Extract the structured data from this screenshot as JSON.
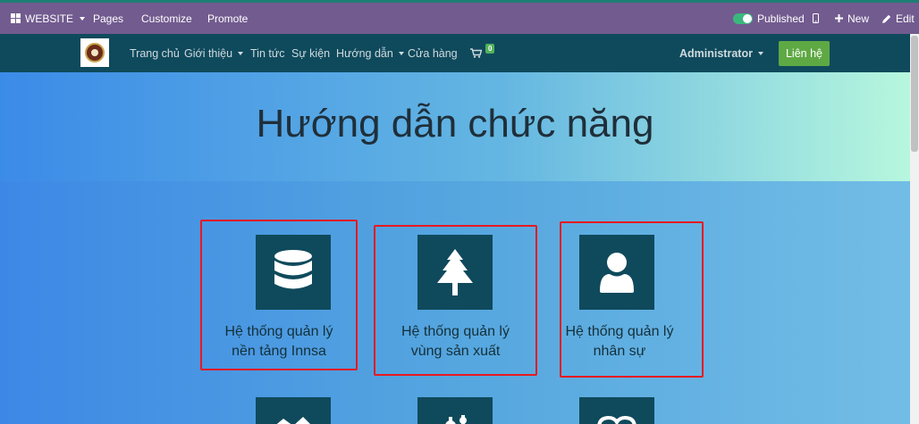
{
  "editor_bar": {
    "website": "WEBSITE",
    "pages": "Pages",
    "customize": "Customize",
    "promote": "Promote",
    "published": "Published",
    "new": "New",
    "edit": "Edit"
  },
  "navbar": {
    "items": [
      "Trang chủ",
      "Giới thiệu",
      "Tin tức",
      "Sự kiện",
      "Hướng dẫn",
      "Cửa hàng"
    ],
    "cart_count": "0",
    "user": "Administrator",
    "contact_button": "Liên hệ"
  },
  "hero": {
    "title": "Hướng dẫn chức năng"
  },
  "cards": [
    {
      "line1": "Hệ thống quản lý",
      "line2": "nền tảng Innsa",
      "icon": "database-icon"
    },
    {
      "line1": "Hệ thống quản lý",
      "line2": "vùng sản xuất",
      "icon": "tree-icon"
    },
    {
      "line1": "Hệ thống quản lý",
      "line2": "nhân sự",
      "icon": "user-icon"
    }
  ],
  "colors": {
    "editor_bar": "#725b8f",
    "navbar": "#0f4a5c",
    "tile": "#0f4a5c",
    "contact_button": "#5fa944",
    "highlight_border": "#e8191f"
  }
}
